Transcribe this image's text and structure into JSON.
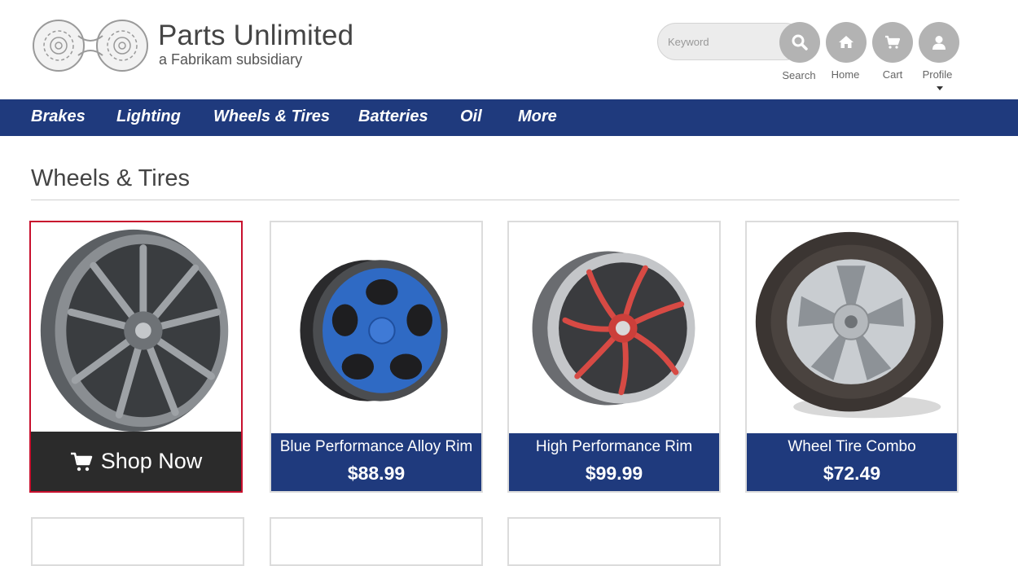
{
  "header": {
    "brand_title": "Parts Unlimited",
    "brand_subtitle": "a Fabrikam subsidiary",
    "search_placeholder": "Keyword",
    "search_label": "Search",
    "home_label": "Home",
    "cart_label": "Cart",
    "profile_label": "Profile"
  },
  "nav": {
    "items": [
      "Brakes",
      "Lighting",
      "Wheels & Tires",
      "Batteries",
      "Oil",
      "More"
    ]
  },
  "main": {
    "title": "Wheels & Tires",
    "shop_now": "Shop Now",
    "products": [
      {
        "name": "",
        "price": "",
        "image": "grey-alloy-rim"
      },
      {
        "name": "Blue Performance Alloy Rim",
        "price": "$88.99",
        "image": "blue-alloy-rim"
      },
      {
        "name": "High Performance Rim",
        "price": "$99.99",
        "image": "red-performance-rim"
      },
      {
        "name": "Wheel Tire Combo",
        "price": "$72.49",
        "image": "wheel-tire-combo"
      }
    ]
  },
  "colors": {
    "nav_bg": "#1f3a7d",
    "selected_border": "#c8102e",
    "shop_now_bg": "#2b2b2b",
    "icon_bg": "#b3b3b3"
  }
}
